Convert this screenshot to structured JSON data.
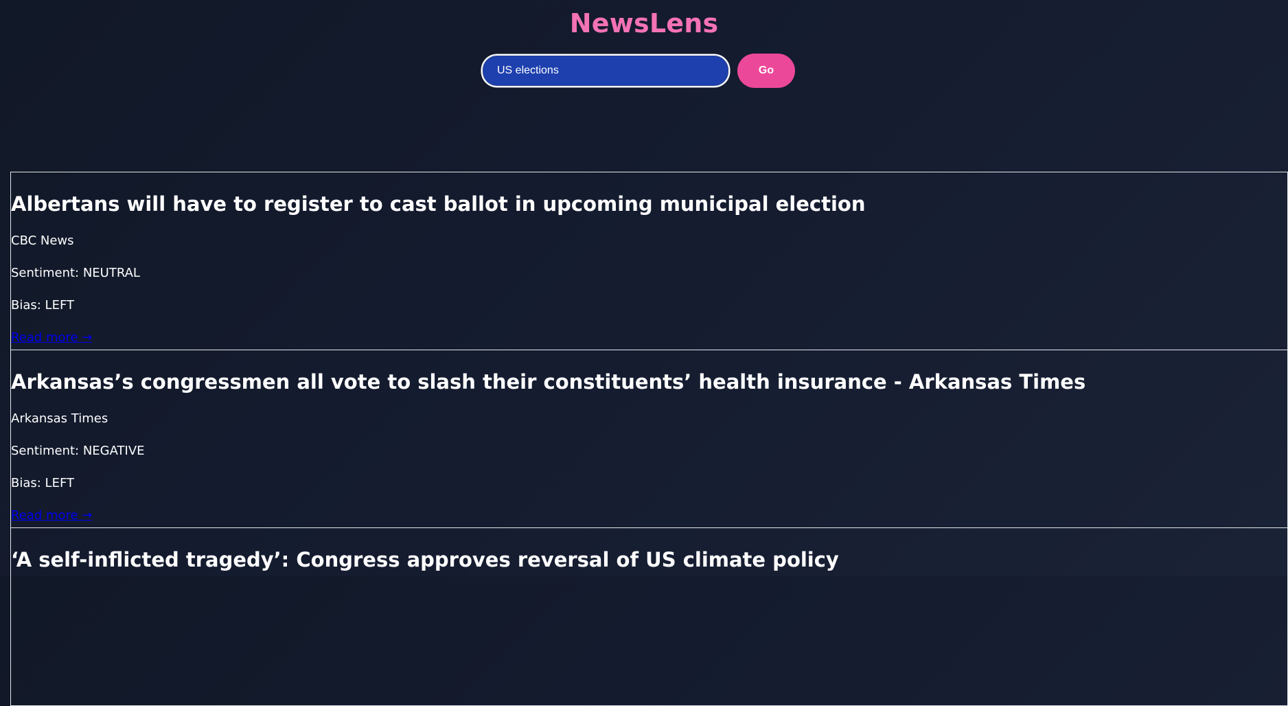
{
  "app": {
    "title": "NewsLens"
  },
  "search": {
    "value": "US elections",
    "button_label": "Go"
  },
  "articles": [
    {
      "title": "Albertans will have to register to cast ballot in upcoming municipal election",
      "source": "CBC News",
      "sentiment": "Sentiment: NEUTRAL",
      "bias": "Bias: LEFT",
      "link_label": "Read more →"
    },
    {
      "title": "Arkansas’s congressmen all vote to slash their constituents’ health insurance - Arkansas Times",
      "source": "Arkansas Times",
      "sentiment": "Sentiment: NEGATIVE",
      "bias": "Bias: LEFT",
      "link_label": "Read more →"
    },
    {
      "title": "‘A self-inflicted tragedy’: Congress approves reversal of US climate policy",
      "source": "",
      "sentiment": "",
      "bias": "",
      "link_label": ""
    }
  ],
  "colors": {
    "background": "#131a2c",
    "accent": "#f472b6",
    "button": "#ec4899",
    "input_bg": "#1e40af",
    "link": "#0000ee"
  }
}
